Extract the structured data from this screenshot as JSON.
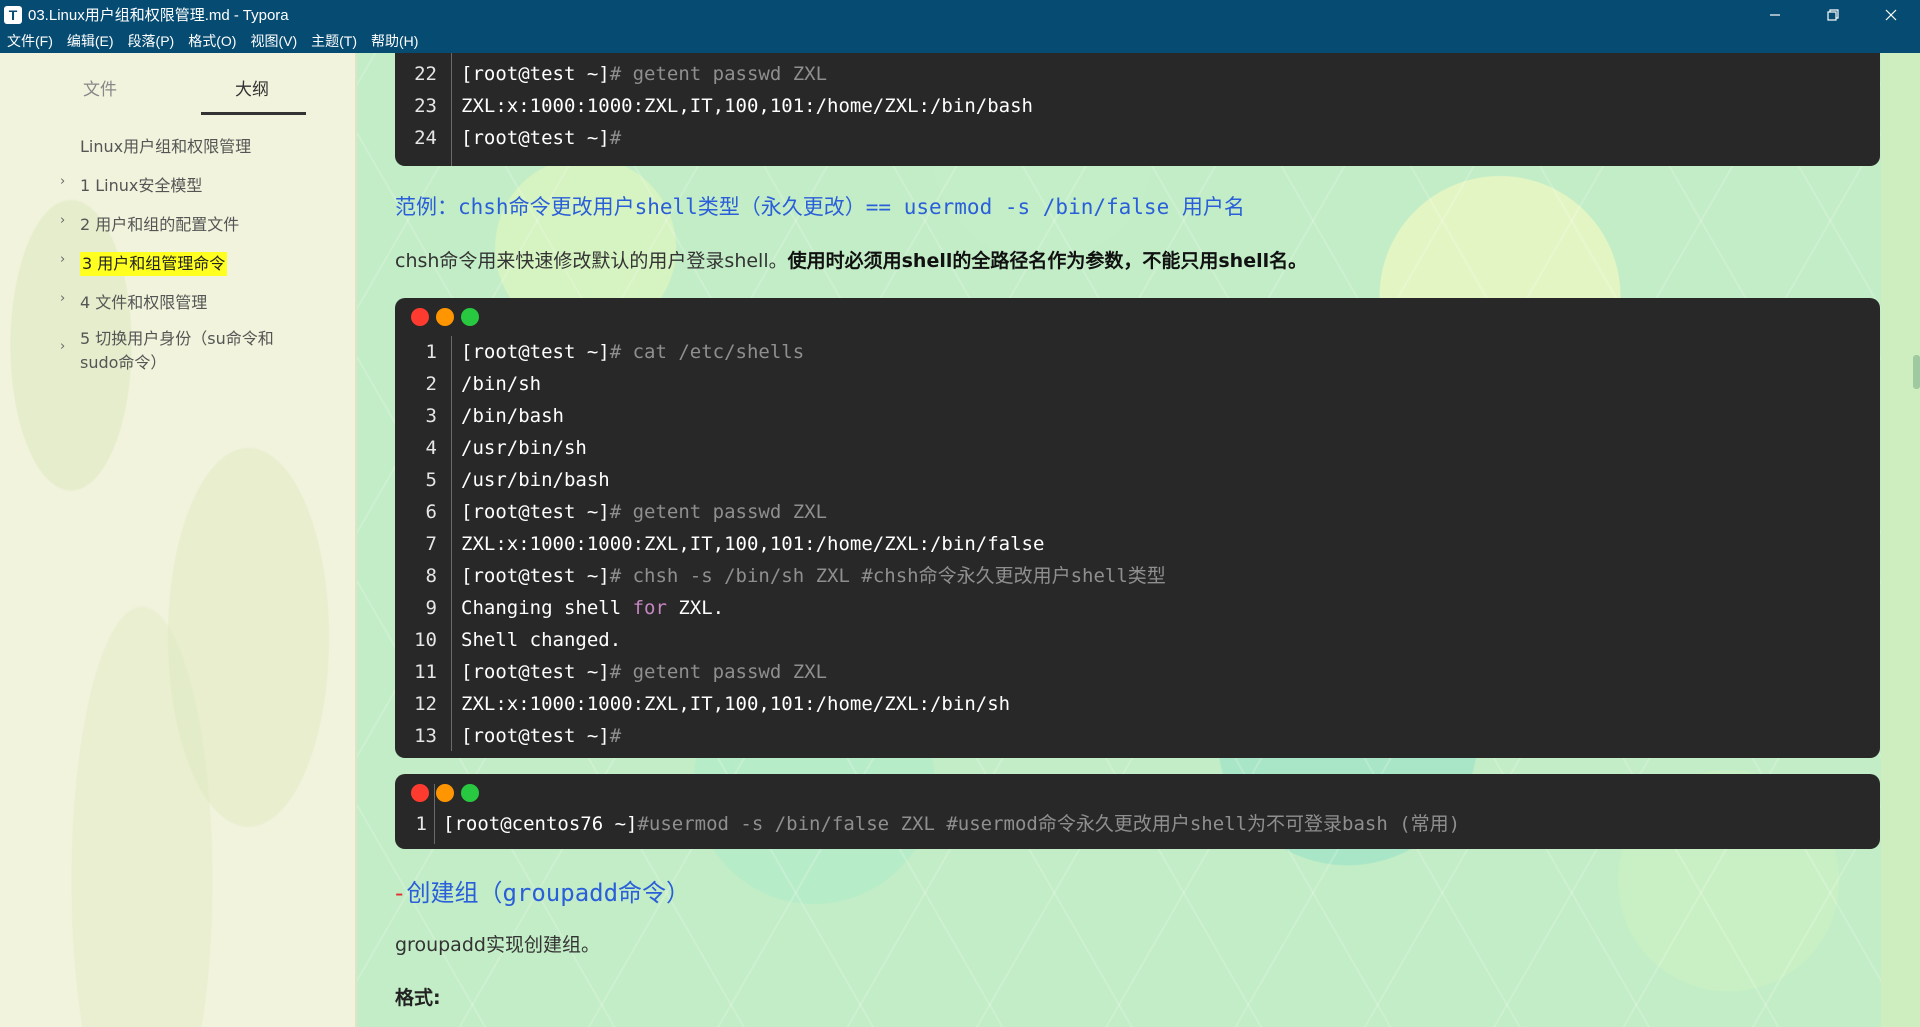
{
  "window": {
    "title": "03.Linux用户组和权限管理.md - Typora",
    "icon_letter": "T"
  },
  "menu": [
    "文件(F)",
    "编辑(E)",
    "段落(P)",
    "格式(O)",
    "视图(V)",
    "主题(T)",
    "帮助(H)"
  ],
  "sidebar": {
    "tabs": [
      {
        "label": "文件",
        "active": false
      },
      {
        "label": "大纲",
        "active": true
      }
    ],
    "outline_title": "Linux用户组和权限管理",
    "items": [
      {
        "label": "1 Linux安全模型",
        "active": false
      },
      {
        "label": "2 用户和组的配置文件",
        "active": false
      },
      {
        "label": "3 用户和组管理命令",
        "active": true
      },
      {
        "label": "4 文件和权限管理",
        "active": false
      },
      {
        "label": "5 切换用户身份（su命令和",
        "label2": "sudo命令）",
        "active": false
      }
    ]
  },
  "content": {
    "block1": {
      "lines": [
        {
          "n": "22",
          "prompt": "[root@test ~]",
          "cmd": "# getent passwd ZXL"
        },
        {
          "n": "23",
          "text": "ZXL:x:1000:1000:ZXL,IT,100,101:/home/ZXL:/bin/bash"
        },
        {
          "n": "24",
          "prompt": "[root@test ~]",
          "cmd": "#"
        }
      ]
    },
    "heading1": "范例：chsh命令更改用户shell类型（永久更改）== usermod -s /bin/false 用户名",
    "para1_normal": "chsh命令用来快速修改默认的用户登录shell。",
    "para1_bold": "使用时必须用shell的全路径名作为参数，不能只用shell名。",
    "block2": {
      "lines": [
        {
          "n": "1",
          "prompt": "[root@test ~]",
          "cmd": "# cat /etc/shells"
        },
        {
          "n": "2",
          "text": "/bin/sh"
        },
        {
          "n": "3",
          "text": "/bin/bash"
        },
        {
          "n": "4",
          "text": "/usr/bin/sh"
        },
        {
          "n": "5",
          "text": "/usr/bin/bash"
        },
        {
          "n": "6",
          "prompt": "[root@test ~]",
          "cmd": "# getent passwd ZXL"
        },
        {
          "n": "7",
          "text": "ZXL:x:1000:1000:ZXL,IT,100,101:/home/ZXL:/bin/false"
        },
        {
          "n": "8",
          "prompt": "[root@test ~]",
          "cmd": "# chsh -s /bin/sh ZXL #chsh命令永久更改用户shell类型"
        },
        {
          "n": "9",
          "text_a": "Changing shell ",
          "kw": "for",
          "text_b": " ZXL."
        },
        {
          "n": "10",
          "text": "Shell changed."
        },
        {
          "n": "11",
          "prompt": "[root@test ~]",
          "cmd": "# getent passwd ZXL"
        },
        {
          "n": "12",
          "text": "ZXL:x:1000:1000:ZXL,IT,100,101:/home/ZXL:/bin/sh"
        },
        {
          "n": "13",
          "prompt": "[root@test ~]",
          "cmd": "#"
        }
      ]
    },
    "block3": {
      "lines": [
        {
          "n": "1",
          "prompt": "[root@centos76 ~]",
          "cmd": "#usermod -s /bin/false ZXL #usermod命令永久更改用户shell为不可登录bash (常用)"
        }
      ]
    },
    "heading2_mark": "-",
    "heading2": "创建组（groupadd命令）",
    "para2": "groupadd实现创建组。",
    "para3": "格式:"
  },
  "colors": {
    "titlebar": "#064b72",
    "code_bg": "#282828",
    "heading": "#2b5fd9",
    "highlight": "#ffff20",
    "dot_red": "#ff3b30",
    "dot_orange": "#ff9500",
    "dot_green": "#28c840"
  }
}
